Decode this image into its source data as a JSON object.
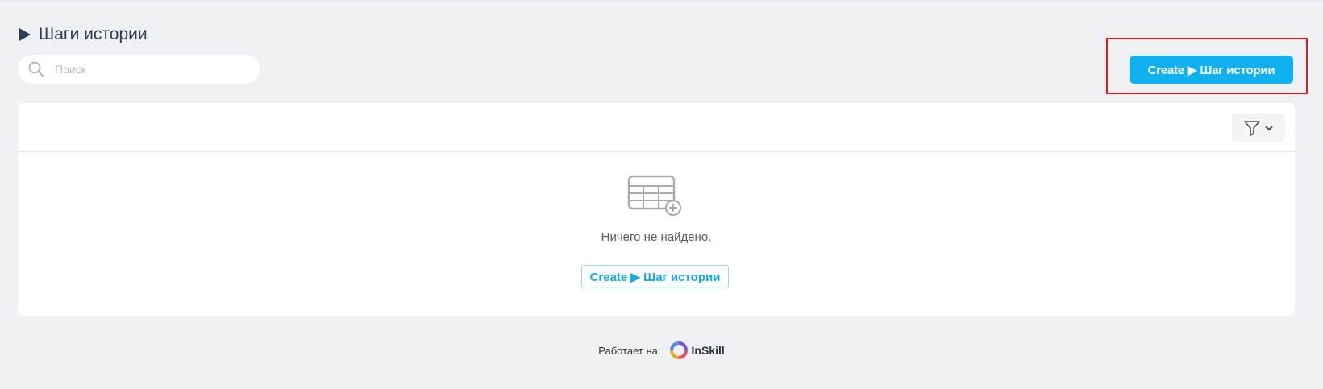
{
  "page": {
    "title": "Шаги истории",
    "title_icon": "play-triangle-icon"
  },
  "search": {
    "placeholder": "Поиск",
    "value": ""
  },
  "toolbar": {
    "create_label": "Create ▶ Шаг истории"
  },
  "table": {
    "filter_icon": "filter-icon",
    "empty_icon": "table-add-icon",
    "empty_text": "Ничего не найдено.",
    "empty_create_label": "Create ▶ Шаг истории"
  },
  "footer": {
    "powered_by_label": "Работает на:",
    "brand_name": "InSkill"
  },
  "colors": {
    "background": "#eef0f3",
    "accent": "#0fb0ef",
    "highlight": "#e01b1b",
    "text": "#2c3e50"
  }
}
